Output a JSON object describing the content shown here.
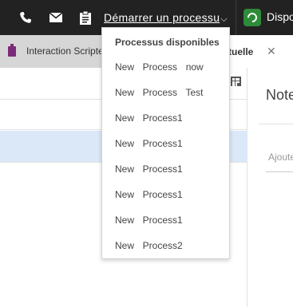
{
  "toolbar": {
    "phone_icon": "phone-icon",
    "mail_icon": "mail-icon",
    "clipboard_icon": "clipboard-icon",
    "start_process_label": "Démarrer un processu",
    "status_label": "Dispor",
    "status_color": "#2e8b3a"
  },
  "tabs": {
    "scripted_label": "Interaction Scripte",
    "scripted_icon_color": "#7b2a79",
    "current_label": "tuelle",
    "close_label": "✕"
  },
  "notes": {
    "title": "Note",
    "input_placeholder": "Ajoute"
  },
  "dropdown": {
    "header": "Processus disponibles",
    "items": [
      "New  Process  now",
      "New  Process  Test",
      "New  Process1",
      "New  Process1",
      "New  Process1",
      "New  Process1",
      "New  Process1",
      "New  Process2"
    ]
  },
  "colors": {
    "toolbar_bg": "#222222",
    "selected_row": "#dbe8f8"
  }
}
